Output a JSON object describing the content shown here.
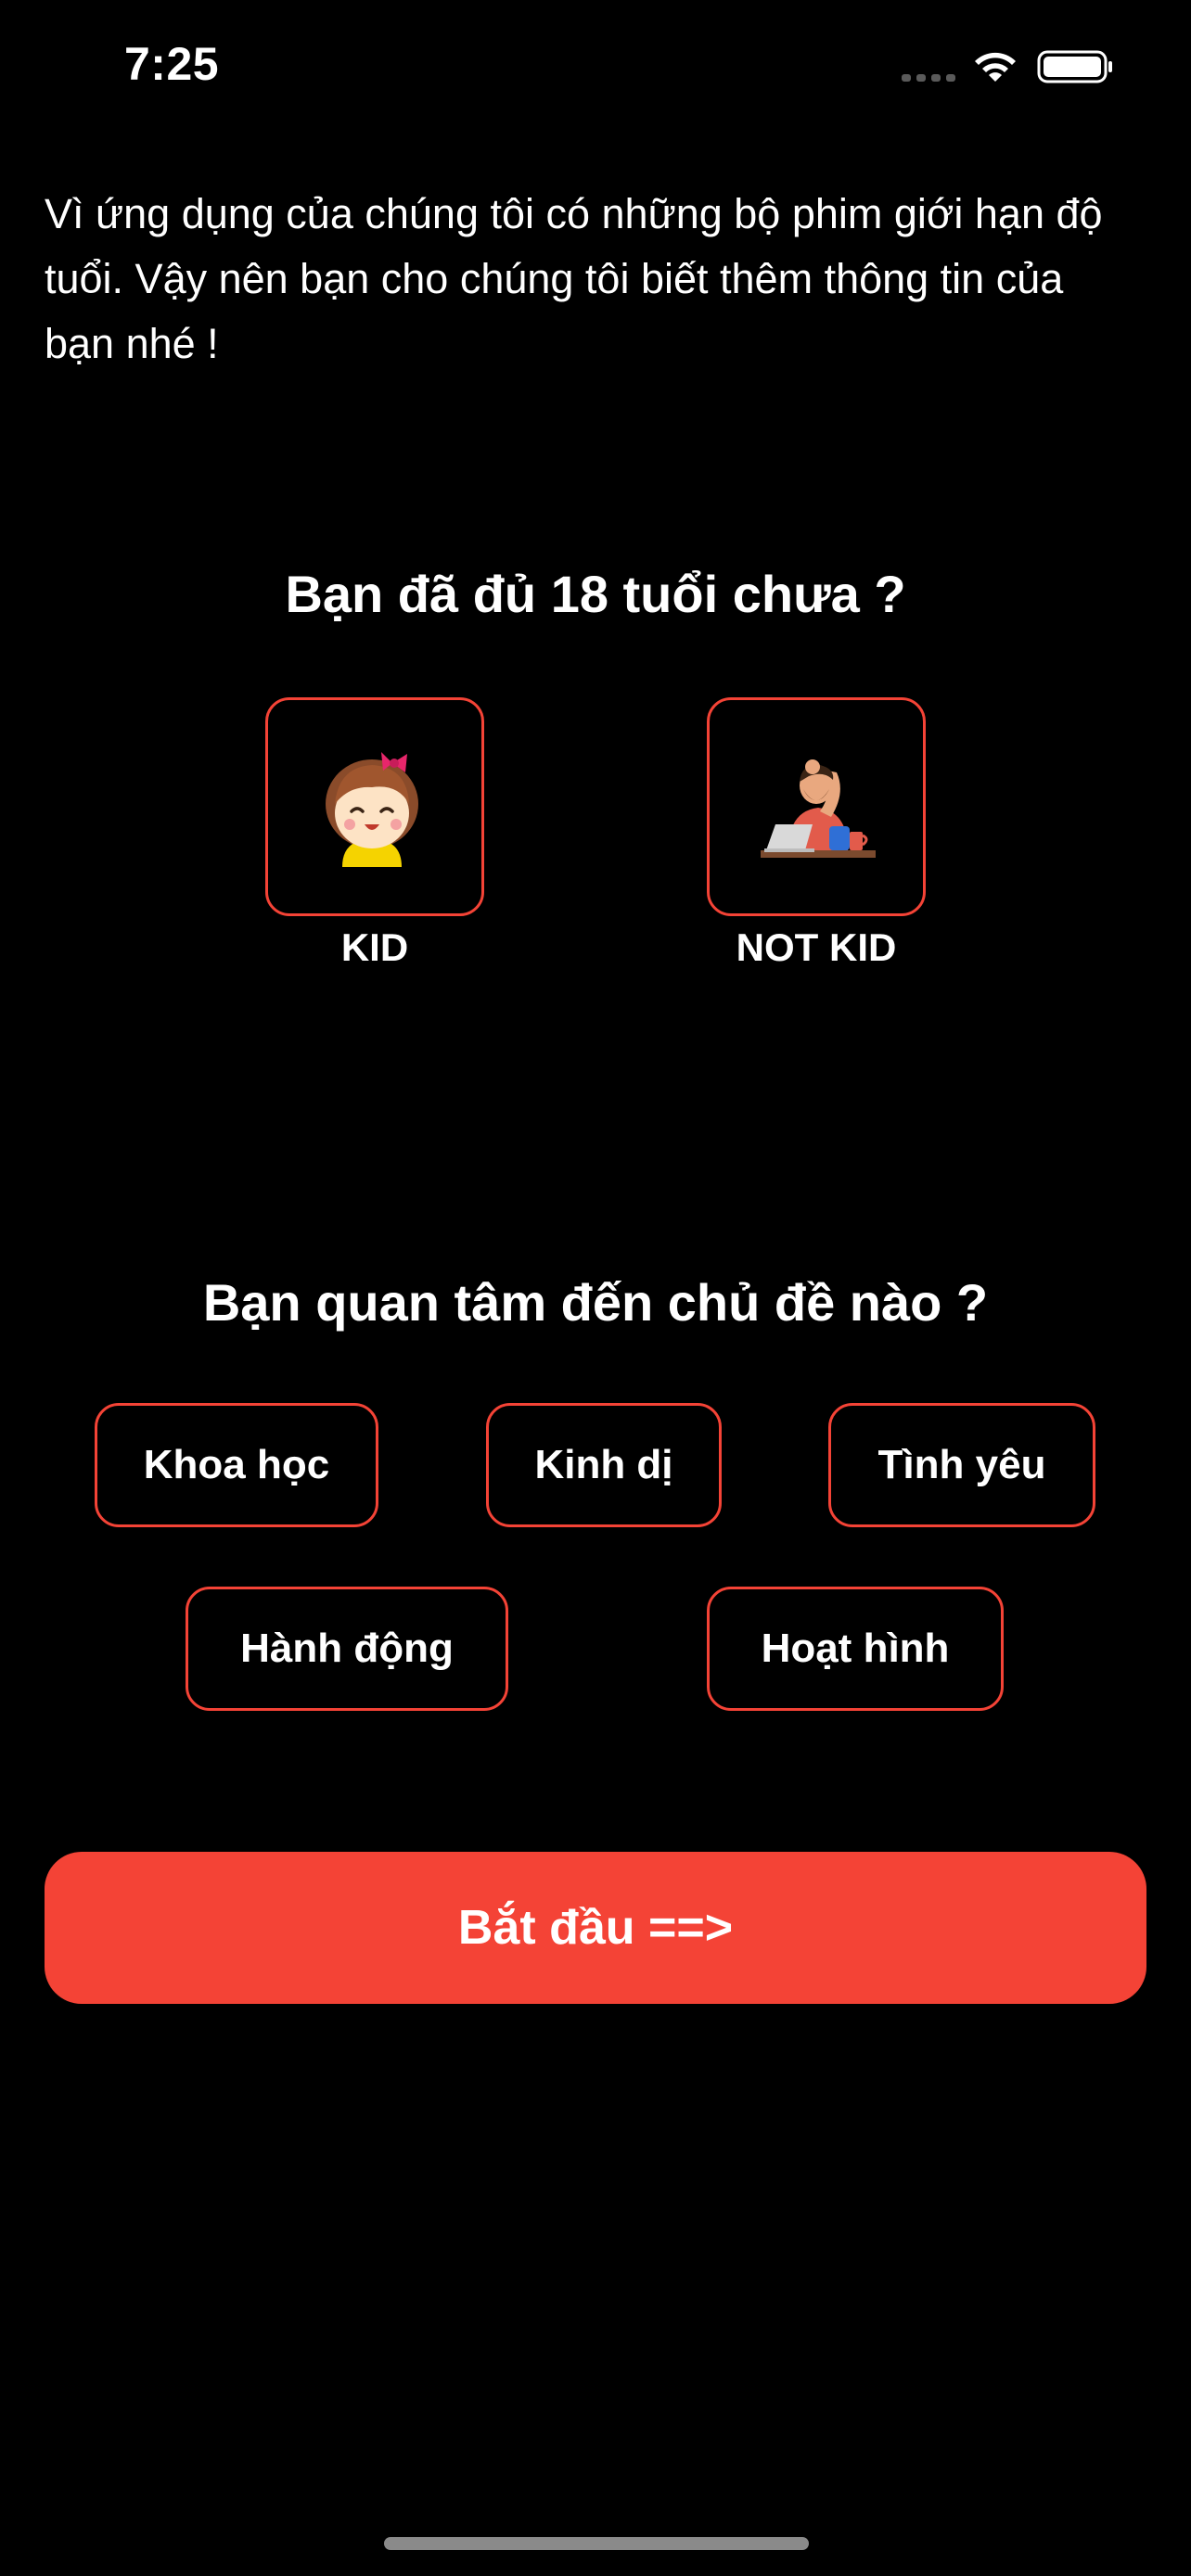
{
  "status_bar": {
    "time": "7:25"
  },
  "intro_text": "Vì ứng dụng của chúng tôi có những bộ phim giới hạn độ tuổi. Vậy nên bạn cho chúng tôi biết thêm thông tin của bạn nhé !",
  "age_section": {
    "title": "Bạn đã đủ 18 tuổi chưa ?",
    "options": [
      {
        "label": "KID",
        "icon": "kid-girl-icon"
      },
      {
        "label": "NOT KID",
        "icon": "adult-at-laptop-icon"
      }
    ]
  },
  "topic_section": {
    "title": "Bạn quan tâm đến chủ đề nào ?",
    "topics": [
      "Khoa học",
      "Kinh dị",
      "Tình yêu",
      "Hành động",
      "Hoạt hình"
    ]
  },
  "start_button": {
    "label": "Bắt đầu ==>"
  },
  "colors": {
    "accent": "#f44336",
    "background": "#000000",
    "text": "#ffffff"
  }
}
